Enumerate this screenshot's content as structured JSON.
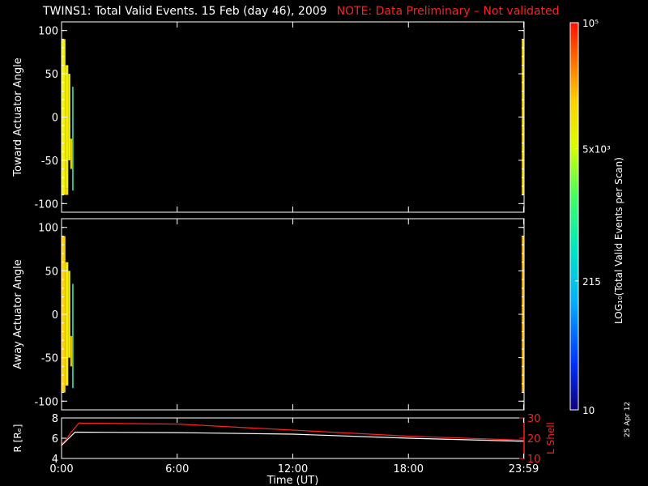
{
  "header": {
    "title": "TWINS1: Total Valid Events. 15 Feb (day  46), 2009",
    "note": "NOTE: Data Preliminary – Not validated"
  },
  "footer": {
    "date_stamp": "25 Apr 12"
  },
  "colors": {
    "background": "#000000",
    "axes": "#ffffff",
    "note": "#ff2020",
    "lshell": "#ff2020",
    "radius": "#ffffff"
  },
  "chart_data": [
    {
      "type": "heatmap",
      "ylabel": "Toward Actuator Angle",
      "ylim": [
        -110,
        110
      ],
      "yticks": [
        100,
        50,
        0,
        -50,
        -100
      ],
      "xlim": [
        0,
        24
      ],
      "cells": [
        {
          "t0": 0.0,
          "t1": 0.2,
          "a0": -90,
          "a1": 90,
          "color": "#f6f300"
        },
        {
          "t0": 0.2,
          "t1": 0.35,
          "a0": -82,
          "a1": 60,
          "color": "#f2e800"
        },
        {
          "t0": 0.2,
          "t1": 0.35,
          "a0": -90,
          "a1": -82,
          "color": "#ffd700"
        },
        {
          "t0": 0.35,
          "t1": 0.45,
          "a0": -50,
          "a1": 50,
          "color": "#f8ff00"
        },
        {
          "t0": 0.45,
          "t1": 0.55,
          "a0": -60,
          "a1": -25,
          "color": "#e0d000"
        },
        {
          "t0": 0.55,
          "t1": 0.62,
          "a0": -85,
          "a1": 35,
          "color": "#28e0b0"
        },
        {
          "t0": 23.88,
          "t1": 24.0,
          "a0": -90,
          "a1": 90,
          "color": "#f2d000"
        }
      ]
    },
    {
      "type": "heatmap",
      "ylabel": "Away Actuator Angle",
      "ylim": [
        -110,
        110
      ],
      "yticks": [
        100,
        50,
        0,
        -50,
        -100
      ],
      "xlim": [
        0,
        24
      ],
      "cells": [
        {
          "t0": 0.0,
          "t1": 0.2,
          "a0": -90,
          "a1": 90,
          "color": "#ffd200"
        },
        {
          "t0": 0.2,
          "t1": 0.35,
          "a0": -82,
          "a1": 60,
          "color": "#f2e800"
        },
        {
          "t0": 0.35,
          "t1": 0.45,
          "a0": -50,
          "a1": 50,
          "color": "#f6f600"
        },
        {
          "t0": 0.45,
          "t1": 0.55,
          "a0": -60,
          "a1": -25,
          "color": "#e8c000"
        },
        {
          "t0": 0.55,
          "t1": 0.62,
          "a0": -85,
          "a1": 35,
          "color": "#28e0b0"
        },
        {
          "t0": 23.88,
          "t1": 24.0,
          "a0": -90,
          "a1": 90,
          "color": "#f2b000"
        }
      ]
    },
    {
      "type": "line",
      "ylabel": "R [Rₑ]",
      "y2label": "L Shell",
      "xlabel": "Time (UT)",
      "xlim": [
        0,
        24
      ],
      "ylim": [
        4,
        8
      ],
      "yticks": [
        8,
        6,
        4
      ],
      "y2lim": [
        10,
        30
      ],
      "y2ticks": [
        30,
        20,
        10
      ],
      "xticks": [
        {
          "t": 0.0,
          "label": "0:00"
        },
        {
          "t": 6.0,
          "label": "6:00"
        },
        {
          "t": 12.0,
          "label": "12:00"
        },
        {
          "t": 18.0,
          "label": "18:00"
        },
        {
          "t": 23.98,
          "label": "23:59"
        }
      ],
      "series": [
        {
          "axis": "left",
          "color": "#ffffff",
          "x": [
            0,
            0.7,
            6,
            12,
            18,
            24
          ],
          "y": [
            5.3,
            6.6,
            6.55,
            6.4,
            6.0,
            5.7
          ]
        },
        {
          "axis": "right",
          "color": "#ff2020",
          "x": [
            0,
            0.25,
            0.5,
            0.9,
            6,
            12,
            18,
            24
          ],
          "y": [
            17,
            19.5,
            23,
            27.5,
            27,
            24,
            21,
            19
          ]
        }
      ]
    }
  ],
  "colorbar": {
    "label": "LOG₁₀(Total Valid Events per Scan)",
    "tick_labels": [
      "10⁵",
      "5x10³",
      "215",
      "10"
    ],
    "range": [
      10,
      100000
    ],
    "scale": "log"
  }
}
